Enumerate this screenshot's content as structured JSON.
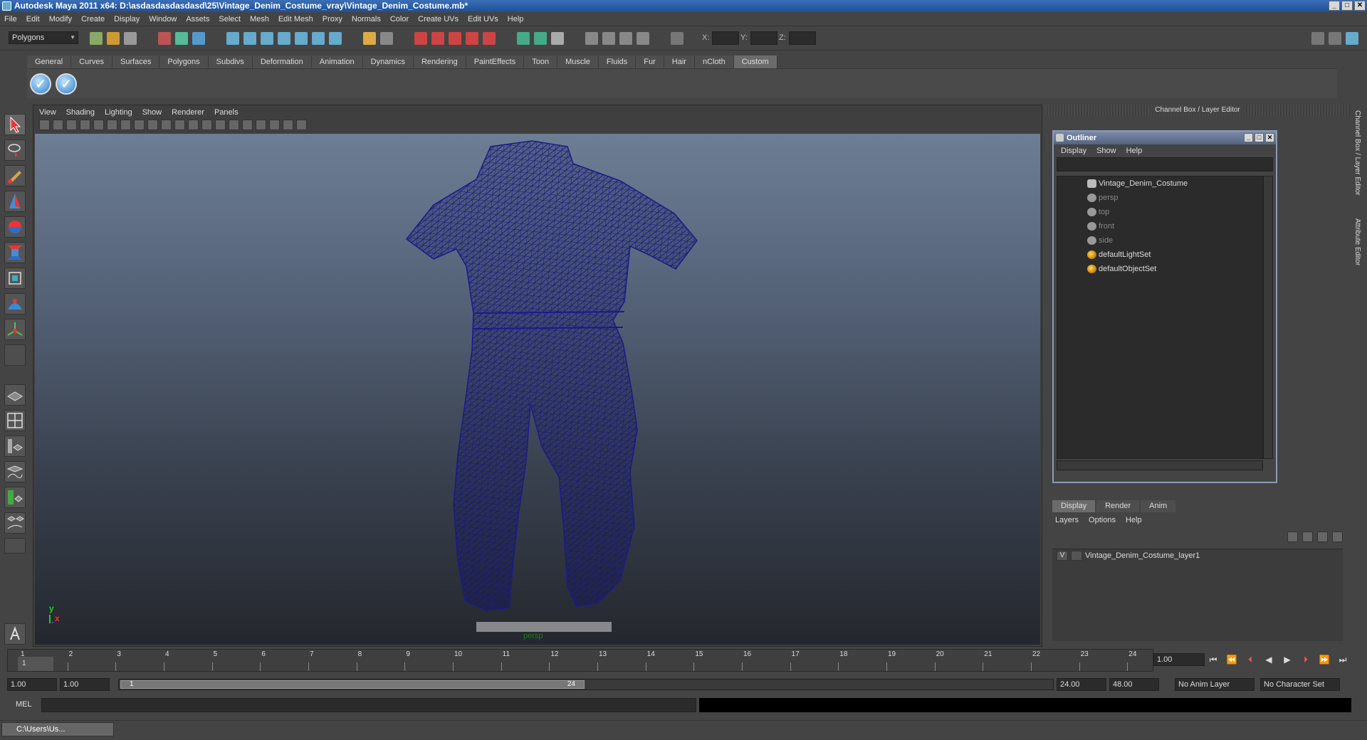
{
  "window": {
    "title": "Autodesk Maya 2011 x64: D:\\asdasdasdasdasd\\25\\Vintage_Denim_Costume_vray\\Vintage_Denim_Costume.mb*",
    "min": "_",
    "max": "□",
    "close": "✕"
  },
  "menu": [
    "File",
    "Edit",
    "Modify",
    "Create",
    "Display",
    "Window",
    "Assets",
    "Select",
    "Mesh",
    "Edit Mesh",
    "Proxy",
    "Normals",
    "Color",
    "Create UVs",
    "Edit UVs",
    "Help"
  ],
  "status": {
    "mode": "Polygons",
    "x_label": "X:",
    "y_label": "Y:",
    "z_label": "Z:"
  },
  "shelf": {
    "tabs": [
      "General",
      "Curves",
      "Surfaces",
      "Polygons",
      "Subdivs",
      "Deformation",
      "Animation",
      "Dynamics",
      "Rendering",
      "PaintEffects",
      "Toon",
      "Muscle",
      "Fluids",
      "Fur",
      "Hair",
      "nCloth",
      "Custom"
    ],
    "active_tab": "Custom",
    "check_glyph": "✓"
  },
  "viewport": {
    "menu": [
      "View",
      "Shading",
      "Lighting",
      "Show",
      "Renderer",
      "Panels"
    ],
    "camera_label": "persp",
    "axis_y": "y",
    "axis_x": "x",
    "wire_color": "#1a1a8c"
  },
  "channel_box": {
    "title": "Channel Box / Layer Editor"
  },
  "outliner": {
    "title": "Outliner",
    "menu": [
      "Display",
      "Show",
      "Help"
    ],
    "items": [
      {
        "label": "Vintage_Denim_Costume",
        "type": "mesh",
        "dim": false
      },
      {
        "label": "persp",
        "type": "camera",
        "dim": true
      },
      {
        "label": "top",
        "type": "camera",
        "dim": true
      },
      {
        "label": "front",
        "type": "camera",
        "dim": true
      },
      {
        "label": "side",
        "type": "camera",
        "dim": true
      },
      {
        "label": "defaultLightSet",
        "type": "set",
        "dim": false
      },
      {
        "label": "defaultObjectSet",
        "type": "set",
        "dim": false
      }
    ]
  },
  "layers": {
    "tabs": [
      "Display",
      "Render",
      "Anim"
    ],
    "active_tab": "Display",
    "menu": [
      "Layers",
      "Options",
      "Help"
    ],
    "rows": [
      {
        "visible": "V",
        "name": "Vintage_Denim_Costume_layer1"
      }
    ]
  },
  "side_tabs": [
    "Channel Box / Layer Editor",
    "Attribute Editor"
  ],
  "timeline": {
    "frames": [
      "1",
      "2",
      "3",
      "4",
      "5",
      "6",
      "7",
      "8",
      "9",
      "10",
      "11",
      "12",
      "13",
      "14",
      "15",
      "16",
      "17",
      "18",
      "19",
      "20",
      "21",
      "22",
      "23",
      "24"
    ],
    "start_marker": "1",
    "current": "1.00"
  },
  "range": {
    "start": "1.00",
    "playback_start": "1.00",
    "thumb_start": "1",
    "thumb_end": "24",
    "playback_end": "24.00",
    "end": "48.00",
    "anim_layer": "No Anim Layer",
    "char_set": "No Character Set"
  },
  "cmd": {
    "label": "MEL"
  },
  "taskbar": {
    "window_label": "C:\\Users\\Us..."
  }
}
